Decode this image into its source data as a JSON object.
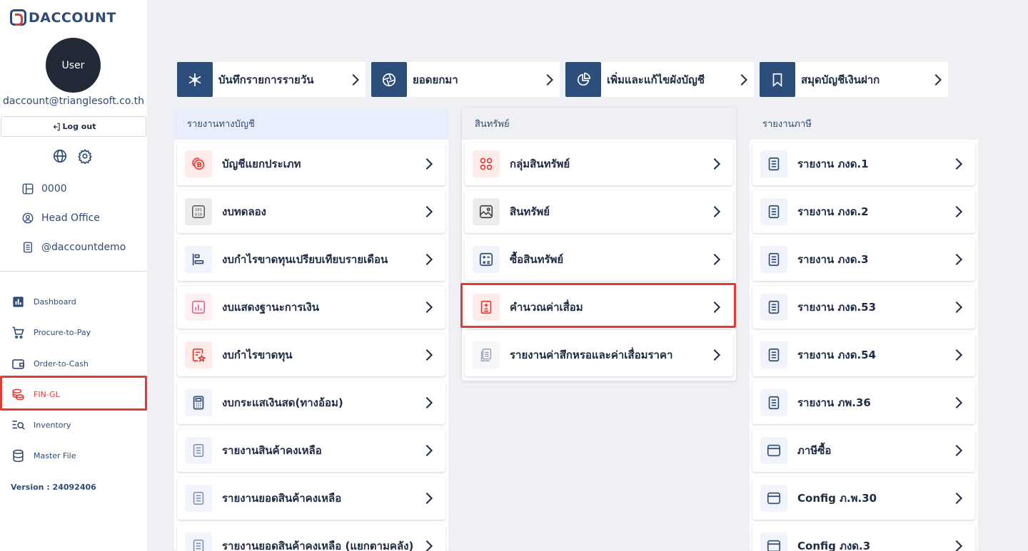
{
  "sidebar": {
    "logo_text": "DACCOUNT",
    "avatar_text": "User",
    "email": "daccount@trianglesoft.co.th",
    "logout_label": "Log out",
    "company_code": "0000",
    "branch": "Head Office",
    "account": "@daccountdemo",
    "nav": [
      {
        "label": "Dashboard",
        "icon": "chart-icon"
      },
      {
        "label": "Procure-to-Pay",
        "icon": "cart-icon"
      },
      {
        "label": "Order-to-Cash",
        "icon": "wallet-icon"
      },
      {
        "label": "FIN-GL",
        "icon": "coins-icon",
        "active": true
      },
      {
        "label": "Inventory",
        "icon": "inventory-search-icon"
      },
      {
        "label": "Master File",
        "icon": "database-icon"
      }
    ],
    "version": "Version : 24092406"
  },
  "quick_actions": [
    {
      "label": "บันทึกรายการรายวัน",
      "icon": "snowflake-icon"
    },
    {
      "label": "ยอดยกมา",
      "icon": "aperture-icon"
    },
    {
      "label": "เพิ่มและแก้ไขผังบัญชี",
      "icon": "pie-chart-icon"
    },
    {
      "label": "สมุดบัญชีเงินฝาก",
      "icon": "bookmark-icon"
    }
  ],
  "columns": [
    {
      "title": "รายงานทางบัญชี",
      "items": [
        {
          "label": "บัญชีแยกประเภท",
          "icon": "coin-icon"
        },
        {
          "label": "งบทดลอง",
          "icon": "binary-icon"
        },
        {
          "label": "งบกำไรขาดทุนเปรียบเทียบรายเดือน",
          "icon": "bars-align-icon"
        },
        {
          "label": "งบแสดงฐานะการเงิน",
          "icon": "bar-chart-icon"
        },
        {
          "label": "งบกำไรขาดทุน",
          "icon": "doc-star-icon"
        },
        {
          "label": "งบกระแสเงินสด(ทางอ้อม)",
          "icon": "calculator-icon"
        },
        {
          "label": "รายงานสินค้าคงเหลือ",
          "icon": "document-icon"
        },
        {
          "label": "รายงานยอดสินค้าคงเหลือ",
          "icon": "document-icon"
        },
        {
          "label": "รายงานยอดสินค้าคงเหลือ (แยกตามคลัง)",
          "icon": "document-icon"
        }
      ]
    },
    {
      "title": "สินทรัพย์",
      "items": [
        {
          "label": "กลุ่มสินทรัพย์",
          "icon": "circles-grid-icon"
        },
        {
          "label": "สินทรัพย์",
          "icon": "image-icon"
        },
        {
          "label": "ซื้อสินทรัพย์",
          "icon": "calc-ops-icon"
        },
        {
          "label": "คำนวณค่าเสื่อม",
          "icon": "plus-minus-doc-icon"
        },
        {
          "label": "รายงานค่าสึกหรอและค่าเสื่อมราคา",
          "icon": "stack-doc-icon"
        }
      ]
    },
    {
      "title": "รายงานภาษี",
      "items": [
        {
          "label": "รายงาน ภงด.1",
          "icon": "document-icon"
        },
        {
          "label": "รายงาน ภงด.2",
          "icon": "document-icon"
        },
        {
          "label": "รายงาน ภงด.3",
          "icon": "document-icon"
        },
        {
          "label": "รายงาน ภงด.53",
          "icon": "document-icon"
        },
        {
          "label": "รายงาน ภงด.54",
          "icon": "document-icon"
        },
        {
          "label": "รายงาน ภพ.36",
          "icon": "document-icon"
        },
        {
          "label": "ภาษีซื้อ",
          "icon": "window-icon"
        },
        {
          "label": "Config ภ.พ.30",
          "icon": "window-icon"
        },
        {
          "label": "Config ภงด.3",
          "icon": "window-icon"
        }
      ]
    }
  ],
  "colors": {
    "brand": "#2d4d7a",
    "accent": "#e53935",
    "text": "#1f2a44"
  }
}
